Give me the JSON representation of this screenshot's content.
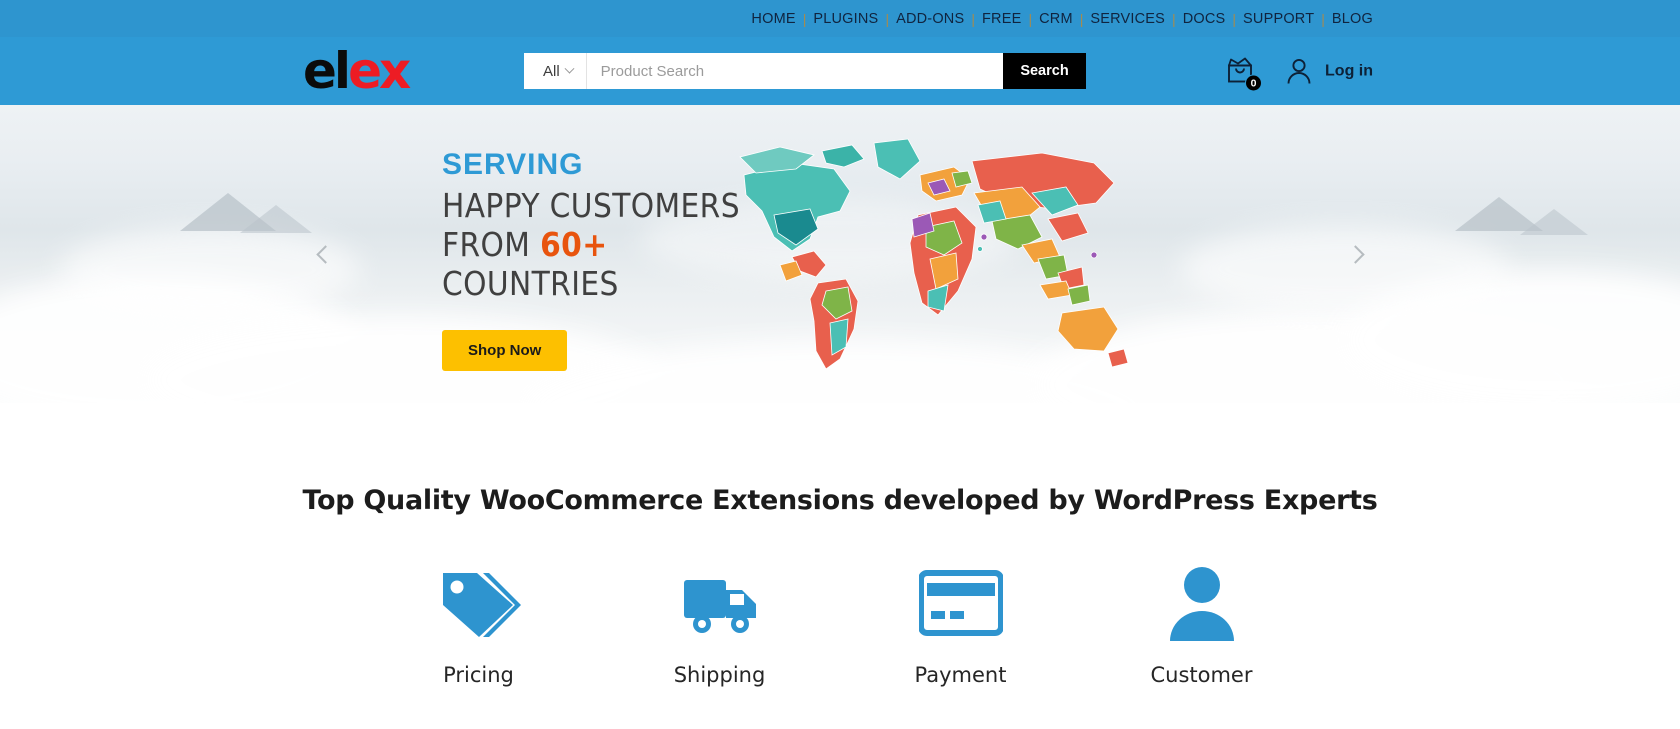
{
  "topnav": {
    "items": [
      {
        "label": "HOME"
      },
      {
        "label": "PLUGINS"
      },
      {
        "label": "ADD-ONS"
      },
      {
        "label": "FREE"
      },
      {
        "label": "CRM"
      },
      {
        "label": "SERVICES"
      },
      {
        "label": "DOCS"
      },
      {
        "label": "SUPPORT"
      },
      {
        "label": "BLOG"
      }
    ],
    "separator": "|"
  },
  "header": {
    "logo": {
      "part1": "el",
      "part2": "ex",
      "color1": "#0b0b0b",
      "color2": "#ed1c24"
    },
    "search": {
      "category_label": "All",
      "placeholder": "Product Search",
      "value": "",
      "button_label": "Search"
    },
    "cart": {
      "count": "0"
    },
    "account": {
      "label": "Log in"
    },
    "background_color": "#2e9ad5"
  },
  "hero": {
    "eyebrow": "SERVING",
    "line1": "HAPPY CUSTOMERS",
    "line2_prefix": "FROM ",
    "line2_highlight": "60+",
    "line3": "COUNTRIES",
    "cta_label": "Shop Now",
    "cta_color": "#fdc000",
    "eyebrow_color": "#2e9ad5",
    "highlight_color": "#e8540e",
    "prev_label": "Previous slide",
    "next_label": "Next slide"
  },
  "features": {
    "heading": "Top Quality WooCommerce Extensions developed by WordPress Experts",
    "accent_color": "#2e94cf",
    "items": [
      {
        "label": "Pricing",
        "icon": "price-tag-icon"
      },
      {
        "label": "Shipping",
        "icon": "delivery-truck-icon"
      },
      {
        "label": "Payment",
        "icon": "credit-card-icon"
      },
      {
        "label": "Customer",
        "icon": "user-person-icon"
      }
    ]
  }
}
